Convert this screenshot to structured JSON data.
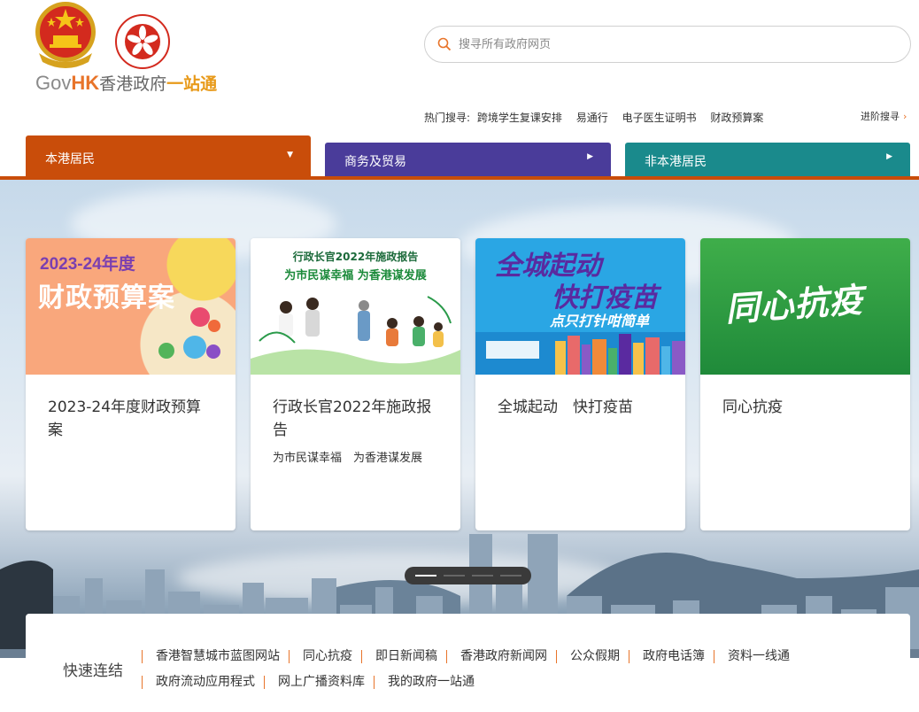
{
  "brand": {
    "gov": "Gov",
    "hk": "HK",
    "name1": "香港政府",
    "name2": "一站通"
  },
  "search": {
    "placeholder": "搜寻所有政府网页"
  },
  "hot_search": {
    "label": "热门搜寻:",
    "items": [
      "跨境学生复课安排",
      "易通行",
      "电子医生证明书",
      "财政预算案"
    ]
  },
  "advanced_search": "进阶搜寻",
  "tabs": [
    {
      "label": "本港居民",
      "color": "#c94d0a"
    },
    {
      "label": "商务及贸易",
      "color": "#4a3c9a"
    },
    {
      "label": "非本港居民",
      "color": "#1a8a8c"
    }
  ],
  "cards": [
    {
      "title": "2023-24年度财政预算案",
      "subtitle": "",
      "img_line1": "2023-24年度",
      "img_line2": "财政预算案"
    },
    {
      "title": "行政长官2022年施政报告",
      "subtitle": "为市民谋幸福　为香港谋发展",
      "img_line1": "行政长官2022年施政报告",
      "img_line2": "为市民谋幸福 为香港谋发展"
    },
    {
      "title": "全城起动　快打疫苗",
      "subtitle": "",
      "img_line1": "全城起动",
      "img_line2": "快打疫苗",
      "img_line3": "点只打针咁简单"
    },
    {
      "title": "同心抗疫",
      "subtitle": "",
      "img_line1": "同心抗疫"
    }
  ],
  "carousel": {
    "slides": 4,
    "active": 1
  },
  "quick_links": {
    "title": "快速连结",
    "row1": [
      "香港智慧城市蓝图网站",
      "同心抗疫",
      "即日新闻稿",
      "香港政府新闻网",
      "公众假期",
      "政府电话簿",
      "资料一线通"
    ],
    "row2": [
      "政府流动应用程式",
      "网上广播资料库",
      "我的政府一站通"
    ]
  }
}
